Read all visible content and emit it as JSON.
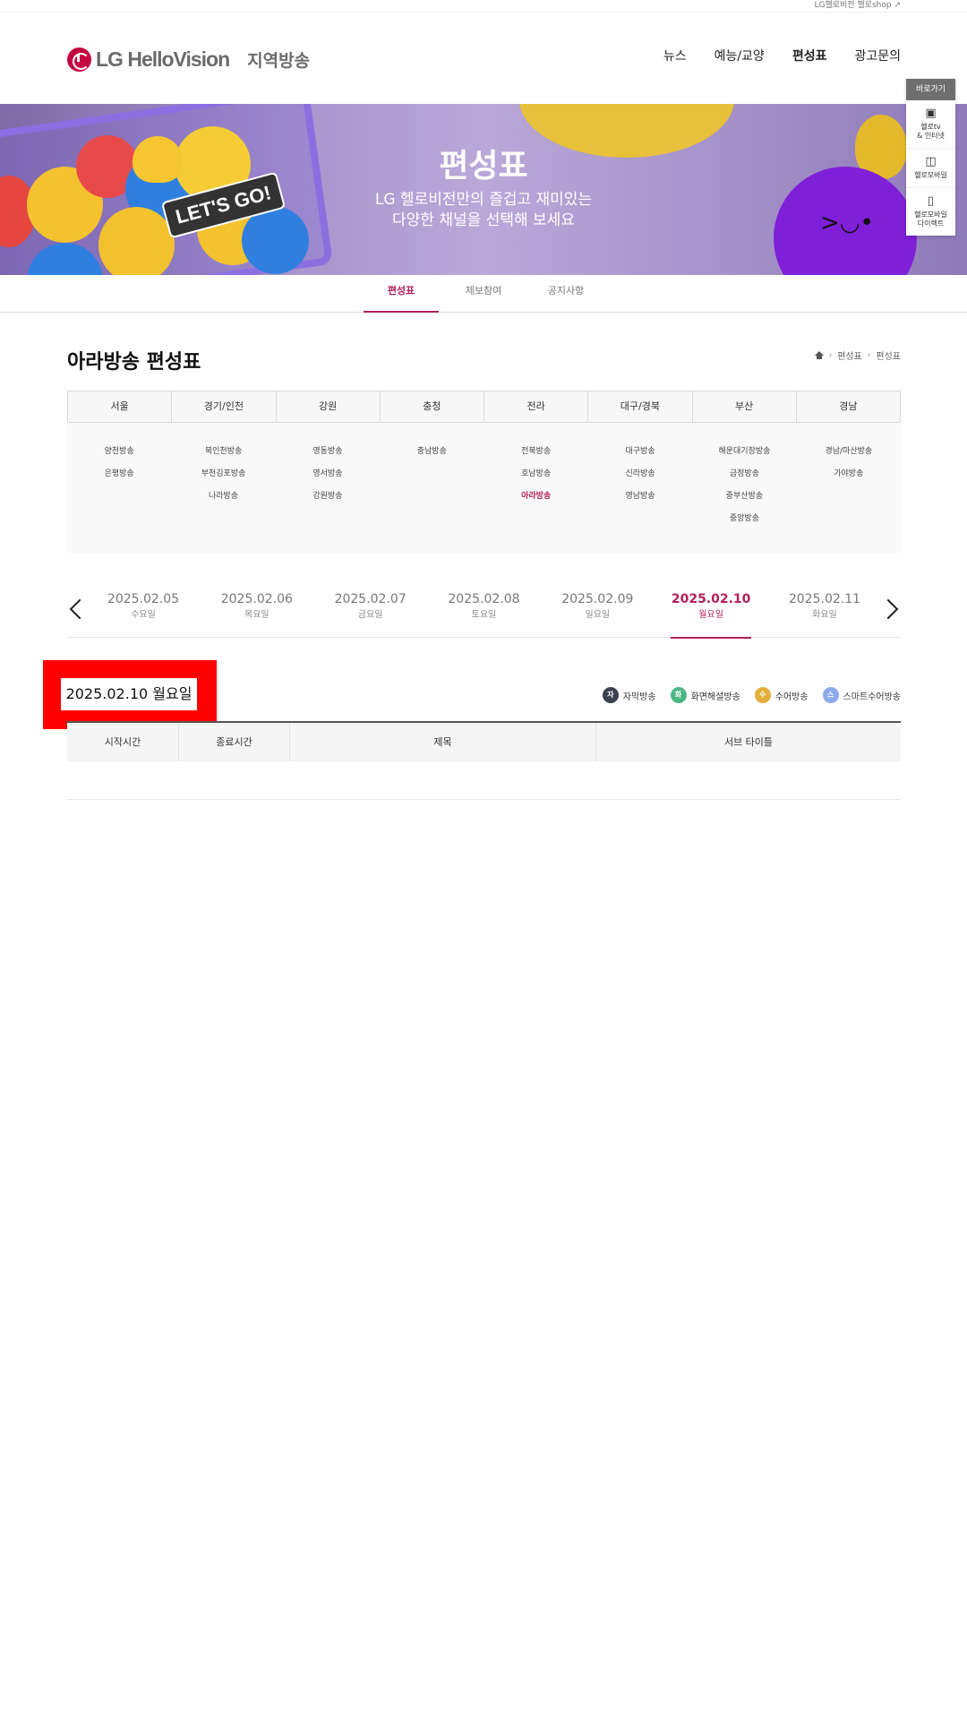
{
  "util": {
    "shop_link": "LG헬로비전 헬로shop ↗"
  },
  "header": {
    "logo_text": "LG HelloVision",
    "logo_sub": "지역방송",
    "nav": [
      "뉴스",
      "예능/교양",
      "편성표",
      "광고문의"
    ],
    "active_nav": "편성표"
  },
  "banner": {
    "title": "편성표",
    "desc_line1": "LG 헬로비전만의 즐겁고 재미있는",
    "desc_line2": "다양한 채널을 선택해 보세요",
    "badge": "LET'S GO!"
  },
  "quick": {
    "head": "바로가기",
    "items": [
      {
        "icon": "tv-internet-icon",
        "line1": "헬로tv",
        "line2": "& 인터넷"
      },
      {
        "icon": "shopping-bag-icon",
        "line1": "헬로모바일",
        "line2": ""
      },
      {
        "icon": "mobile-direct-icon",
        "line1": "헬로모바일",
        "line2": "다이렉트"
      }
    ]
  },
  "subtabs": [
    "편성표",
    "제보참여",
    "공지사항"
  ],
  "page": {
    "title": "아라방송 편성표",
    "breadcrumb": [
      "편성표",
      "편성표"
    ]
  },
  "regions": {
    "headers": [
      "서울",
      "경기/인천",
      "강원",
      "충청",
      "전라",
      "대구/경북",
      "부산",
      "경남"
    ],
    "columns": [
      [
        "양천방송",
        "은평방송"
      ],
      [
        "북인천방송",
        "부천김포방송",
        "나라방송"
      ],
      [
        "영동방송",
        "영서방송",
        "강원방송"
      ],
      [
        "충남방송"
      ],
      [
        "전북방송",
        "호남방송",
        "아라방송"
      ],
      [
        "대구방송",
        "신라방송",
        "영남방송"
      ],
      [
        "해운대기장방송",
        "금정방송",
        "중부산방송",
        "중앙방송"
      ],
      [
        "경남/마산방송",
        "가야방송"
      ]
    ],
    "active": "아라방송"
  },
  "dates": [
    {
      "date": "2025.02.05",
      "day": "수요일"
    },
    {
      "date": "2025.02.06",
      "day": "목요일"
    },
    {
      "date": "2025.02.07",
      "day": "금요일"
    },
    {
      "date": "2025.02.08",
      "day": "토요일"
    },
    {
      "date": "2025.02.09",
      "day": "일요일"
    },
    {
      "date": "2025.02.10",
      "day": "월요일"
    },
    {
      "date": "2025.02.11",
      "day": "화요일"
    }
  ],
  "active_date": "2025.02.10",
  "selected_date_label": "2025.02.10 월요일",
  "legend": [
    {
      "mark": "자",
      "label": "자막방송",
      "color": "#3c4150"
    },
    {
      "mark": "화",
      "label": "화면해설방송",
      "color": "#4cb686"
    },
    {
      "mark": "수",
      "label": "수어방송",
      "color": "#e2ad3b"
    },
    {
      "mark": "스",
      "label": "스마트수어방송",
      "color": "#8ea9ea"
    }
  ],
  "table": {
    "headers": [
      "시작시간",
      "종료시간",
      "제목",
      "서브 타이틀"
    ]
  },
  "colors": {
    "accent": "#b3205b",
    "highlight": "#ff0000"
  }
}
